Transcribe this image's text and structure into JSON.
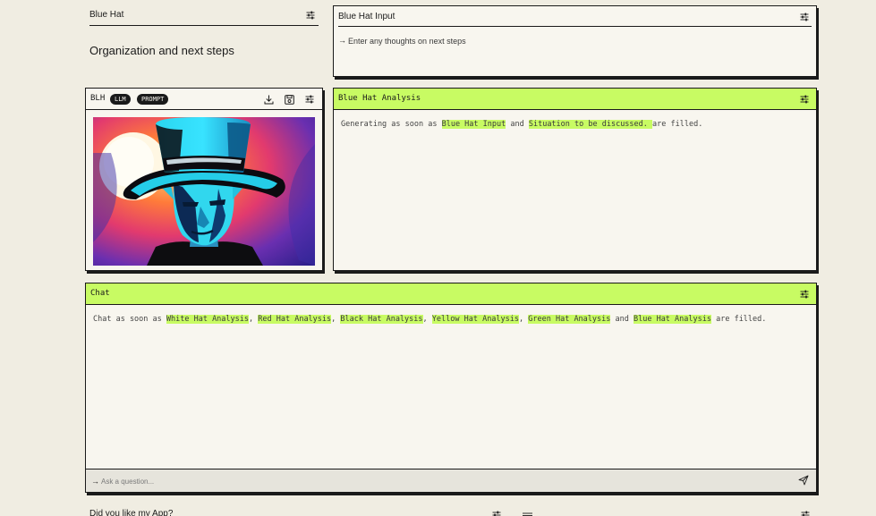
{
  "title_section": {
    "hat_title": "Blue Hat",
    "subtitle": "Organization and next steps"
  },
  "input_card": {
    "title": "Blue Hat Input",
    "arrow": "→",
    "placeholder": "Enter any thoughts on next steps"
  },
  "blh_card": {
    "title": "BLH",
    "pill_llm": "LLM",
    "pill_prompt": "PROMPT",
    "image_alt": "Illustration of a man in a cyan top hat"
  },
  "analysis_card": {
    "title": "Blue Hat Analysis",
    "message": {
      "prefix": "Generating as soon as ",
      "ref1": "Blue Hat Input",
      "and": " and ",
      "ref2": "Situation to be discussed. ",
      "suffix": " are filled."
    }
  },
  "chat_card": {
    "title": "Chat",
    "message": {
      "prefix": "Chat as soon as ",
      "refs": [
        "White Hat Analysis",
        "Red Hat Analysis",
        "Black Hat Analysis",
        "Yellow Hat Analysis",
        "Green Hat Analysis",
        "Blue Hat Analysis"
      ],
      "sep": ", ",
      "and": " and ",
      "suffix": " are filled."
    },
    "input_arrow": "→",
    "input_placeholder": "Ask a question..."
  },
  "feedback_section": {
    "title": "Did you like my App?"
  },
  "colors": {
    "background": "#f0ede2",
    "accent": "#c8fb63",
    "card": "#f8f6ef",
    "ink": "#1a1a1a"
  },
  "icons": {
    "settings": "sliders-icon",
    "download": "download-icon",
    "save": "save-icon",
    "send": "send-icon",
    "arrow": "arrow-right-icon",
    "drag": "drag-handle-icon"
  }
}
